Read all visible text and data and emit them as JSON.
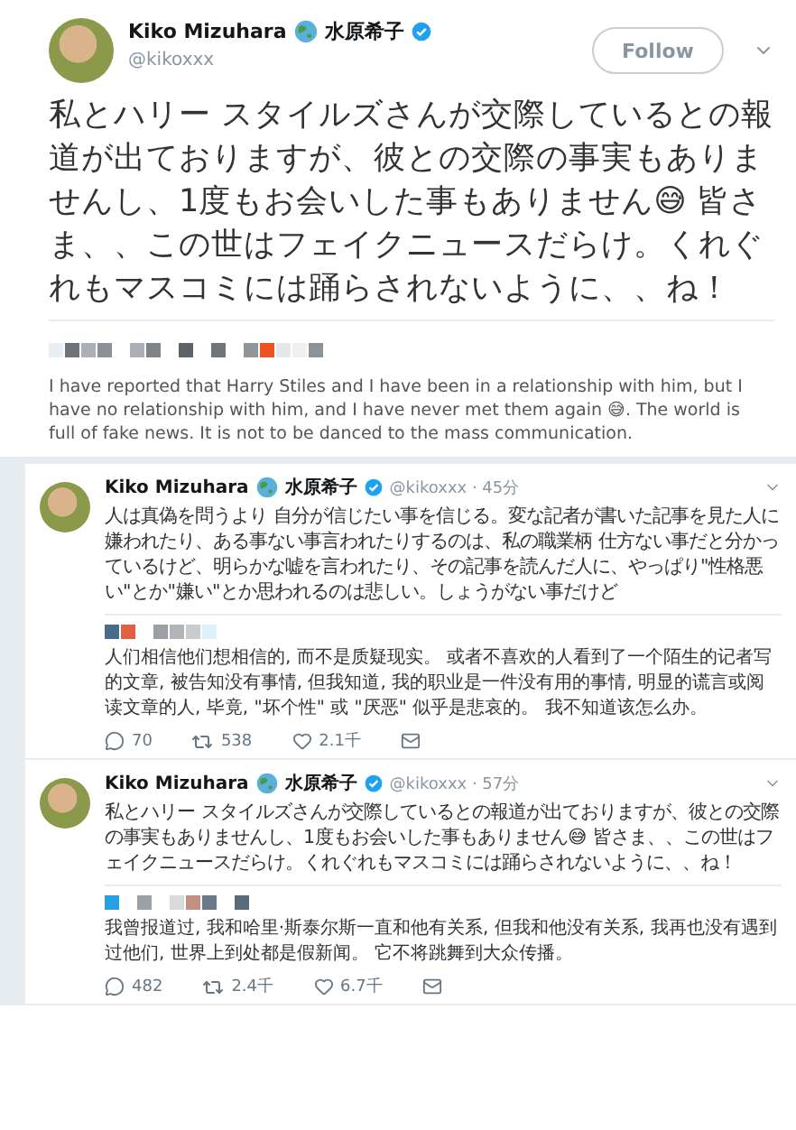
{
  "main_tweet": {
    "display_name": "Kiko Mizuhara",
    "name_jp": "水原希子",
    "handle": "@kikoxxx",
    "follow_button": "Follow",
    "text": "私とハリー スタイルズさんが交際しているとの報道が出ておりますが、彼との交際の事実もありませんし、1度もお会いした事もありません😅 皆さま、、この世はフェイクニュースだらけ。くれぐれもマスコミには踊らされないように、、ね！",
    "translation": "I have reported that Harry Stiles and I have been in a relationship with him, but I have no relationship with him, and I have never met them again 😅. The world is full of fake news. It is not to be danced to the mass communication."
  },
  "timeline": [
    {
      "display_name": "Kiko Mizuhara",
      "name_jp": "水原希子",
      "handle_time": "@kikoxxx · 45分",
      "text": "人は真偽を問うより 自分が信じたい事を信じる。変な記者が書いた記事を見た人に嫌われたり、ある事ない事言われたりするのは、私の職業柄 仕方ない事だと分かっているけど、明らかな嘘を言われたり、その記事を読んだ人に、やっぱり\"性格悪い\"とか\"嫌い\"とか思われるのは悲しい。しょうがない事だけど",
      "translation": "人们相信他们想相信的, 而不是质疑现实。 或者不喜欢的人看到了一个陌生的记者写的文章, 被告知没有事情, 但我知道, 我的职业是一件没有用的事情, 明显的谎言或阅读文章的人, 毕竟, \"坏个性\" 或 \"厌恶\" 似乎是悲哀的。 我不知道该怎么办。",
      "replies": "70",
      "retweets": "538",
      "likes": "2.1千"
    },
    {
      "display_name": "Kiko Mizuhara",
      "name_jp": "水原希子",
      "handle_time": "@kikoxxx · 57分",
      "text": "私とハリー スタイルズさんが交際しているとの報道が出ておりますが、彼との交際の事実もありませんし、1度もお会いした事もありません😅 皆さま、、この世はフェイクニュースだらけ。くれぐれもマスコミには踊らされないように、、ね！",
      "translation": "我曾报道过, 我和哈里·斯泰尔斯一直和他有关系, 但我和他没有关系, 我再也没有遇到过他们, 世界上到处都是假新闻。 它不将跳舞到大众传播。",
      "replies": "482",
      "retweets": "2.4千",
      "likes": "6.7千"
    }
  ]
}
